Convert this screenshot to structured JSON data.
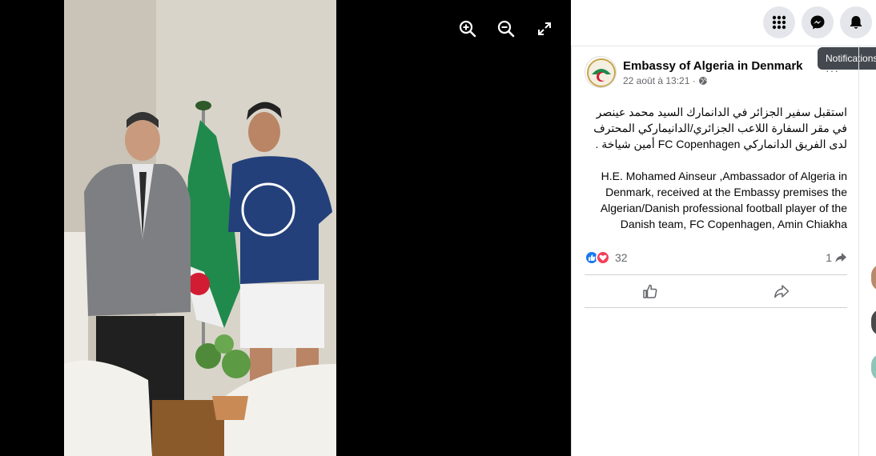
{
  "viewer": {
    "tools": [
      {
        "icon": "zoom-in-icon"
      },
      {
        "icon": "zoom-out-icon"
      },
      {
        "icon": "fullscreen-icon"
      }
    ]
  },
  "topbar": {
    "buttons": [
      {
        "icon": "menu-grid-icon"
      },
      {
        "icon": "messenger-icon"
      },
      {
        "icon": "bell-icon"
      }
    ],
    "tooltip": "Notifications"
  },
  "post": {
    "page_name": "Embassy of Algeria in Denmark",
    "date": "22 août à 13:21 ·",
    "text_ar": "استقبل سفير الجزائر في الدانمارك السيد محمد عينصر في مقر السفارة اللاعب الجزائري/الدانيماركي المحترف لدى الفريق الدانماركي FC Copenhagen أمين شياخة .",
    "text_en": "H.E. Mohamed Ainseur ,Ambassador of Algeria in Denmark, received at the Embassy premises the Algerian/Danish professional football player of the Danish team, FC Copenhagen, Amin Chiakha",
    "reaction_count": "32",
    "share_count": "1",
    "more": "···"
  },
  "colors": {
    "like_blue": "#1877f2",
    "love_red": "#f33e58",
    "algeria_green": "#1f8a4c",
    "shirt_blue": "#23407a"
  }
}
